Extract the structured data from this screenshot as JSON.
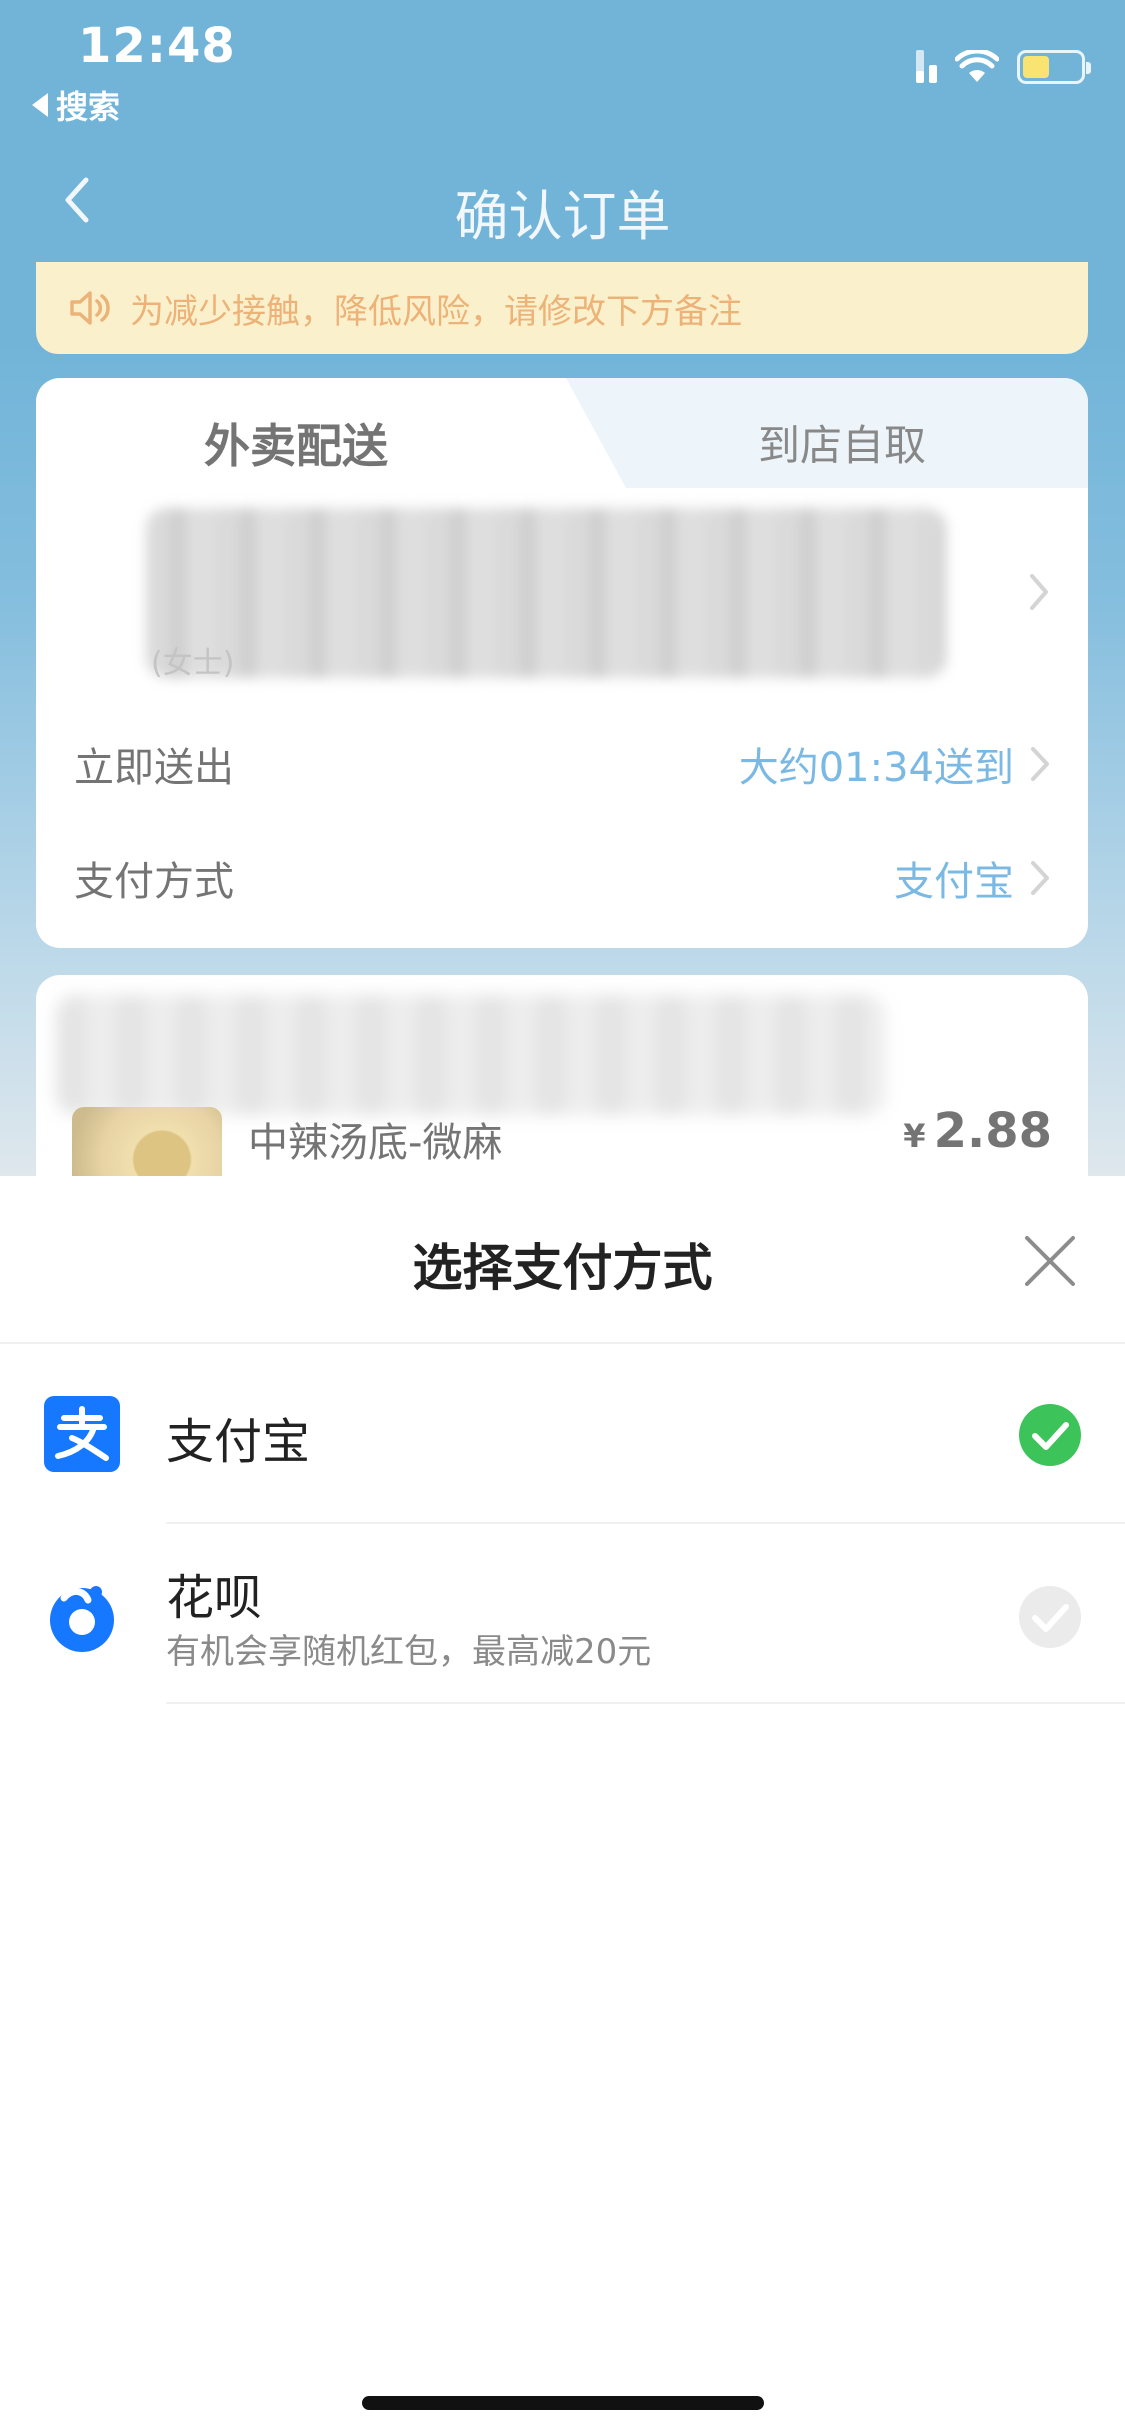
{
  "status_bar": {
    "time": "12:48",
    "back_app": "搜索"
  },
  "nav": {
    "title": "确认订单"
  },
  "notice": {
    "text": "为减少接触，降低风险，请修改下方备注",
    "accent": "#e07b17"
  },
  "order": {
    "tabs": [
      {
        "label": "外卖配送",
        "active": true
      },
      {
        "label": "到店自取",
        "active": false
      }
    ],
    "address_partial": "(女士)",
    "delivery": {
      "label": "立即送出",
      "value": "大约01:34送到"
    },
    "payment": {
      "label": "支付方式",
      "value": "支付宝"
    }
  },
  "goods": {
    "name": "中辣汤底-微麻",
    "currency": "¥",
    "price": "2.88"
  },
  "sheet": {
    "title": "选择支付方式",
    "options": [
      {
        "name": "支付宝",
        "sub": "",
        "selected": true,
        "icon": "alipay-icon"
      },
      {
        "name": "花呗",
        "sub": "有机会享随机红包，最高减20元",
        "selected": false,
        "icon": "huabei-icon"
      }
    ]
  },
  "colors": {
    "brand_blue": "#0b7ebc",
    "link_blue": "#1b87d0",
    "check_green": "#3cc45a",
    "alipay_blue": "#1677ff"
  }
}
